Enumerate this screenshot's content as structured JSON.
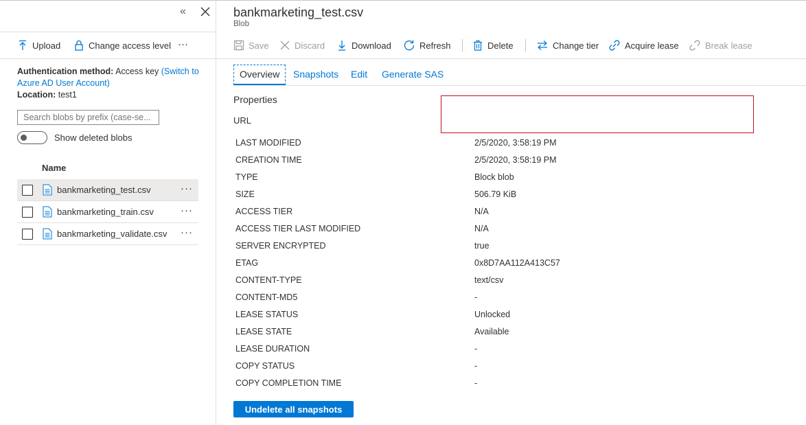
{
  "left_panel": {
    "collapse_glyph": "«",
    "toolbar": {
      "upload": "Upload",
      "change_access": "Change access level",
      "more": "···"
    },
    "auth_label": "Authentication method:",
    "auth_value": "Access key",
    "auth_switch_link": "(Switch to Azure AD User Account)",
    "location_label": "Location:",
    "location_value": "test1",
    "search_placeholder": "Search blobs by prefix (case-se...",
    "show_deleted_label": "Show deleted blobs",
    "column_name": "Name",
    "files": [
      {
        "name": "bankmarketing_test.csv",
        "more": "···"
      },
      {
        "name": "bankmarketing_train.csv",
        "more": "···"
      },
      {
        "name": "bankmarketing_validate.csv",
        "more": "···"
      }
    ]
  },
  "right_panel": {
    "title": "bankmarketing_test.csv",
    "subtitle": "Blob",
    "toolbar": {
      "save": "Save",
      "discard": "Discard",
      "download": "Download",
      "refresh": "Refresh",
      "delete": "Delete",
      "change_tier": "Change tier",
      "acquire_lease": "Acquire lease",
      "break_lease": "Break lease"
    },
    "tabs": [
      "Overview",
      "Snapshots",
      "Edit",
      "Generate SAS"
    ],
    "properties_title": "Properties",
    "url_label": "URL",
    "properties": [
      {
        "key": "LAST MODIFIED",
        "value": "2/5/2020, 3:58:19 PM"
      },
      {
        "key": "CREATION TIME",
        "value": "2/5/2020, 3:58:19 PM"
      },
      {
        "key": "TYPE",
        "value": "Block blob"
      },
      {
        "key": "SIZE",
        "value": "506.79 KiB"
      },
      {
        "key": "ACCESS TIER",
        "value": "N/A"
      },
      {
        "key": "ACCESS TIER LAST MODIFIED",
        "value": "N/A"
      },
      {
        "key": "SERVER ENCRYPTED",
        "value": "true"
      },
      {
        "key": "ETAG",
        "value": "0x8D7AA112A413C57"
      },
      {
        "key": "CONTENT-TYPE",
        "value": "text/csv"
      },
      {
        "key": "CONTENT-MD5",
        "value": "-"
      },
      {
        "key": "LEASE STATUS",
        "value": "Unlocked"
      },
      {
        "key": "LEASE STATE",
        "value": "Available"
      },
      {
        "key": "LEASE DURATION",
        "value": "-"
      },
      {
        "key": "COPY STATUS",
        "value": "-"
      },
      {
        "key": "COPY COMPLETION TIME",
        "value": "-"
      }
    ],
    "undelete_button": "Undelete all snapshots"
  },
  "colors": {
    "accent": "#0078d4",
    "url_box_border": "#c50f1f",
    "selected_row": "#edebe9"
  }
}
